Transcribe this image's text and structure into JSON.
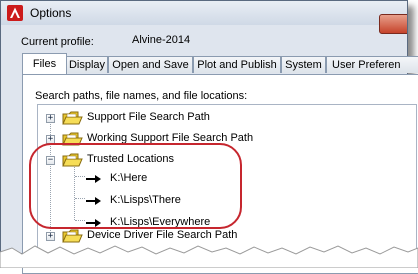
{
  "window": {
    "title": "Options",
    "app_icon": "autocad-a-icon"
  },
  "profile": {
    "label": "Current profile:",
    "value": "Alvine-2014"
  },
  "tabs": [
    {
      "label": "Files",
      "active": true
    },
    {
      "label": "Display"
    },
    {
      "label": "Open and Save"
    },
    {
      "label": "Plot and Publish"
    },
    {
      "label": "System"
    },
    {
      "label": "User Preferen"
    }
  ],
  "files": {
    "section_label": "Search paths, file names, and file locations:",
    "tree": [
      {
        "label": "Support File Search Path",
        "expander": "+"
      },
      {
        "label": "Working Support File Search Path",
        "expander": "+"
      },
      {
        "label": "Trusted Locations",
        "expander": "−",
        "children": [
          "K:\\Here",
          "K:\\Lisps\\There",
          "K:\\Lisps\\Everywhere"
        ]
      },
      {
        "label": "Device Driver File Search Path",
        "expander": "+"
      }
    ]
  },
  "colors": {
    "highlight": "#c6262e",
    "title_icon": "#cc1b1b",
    "folder": "#f2d23a"
  }
}
